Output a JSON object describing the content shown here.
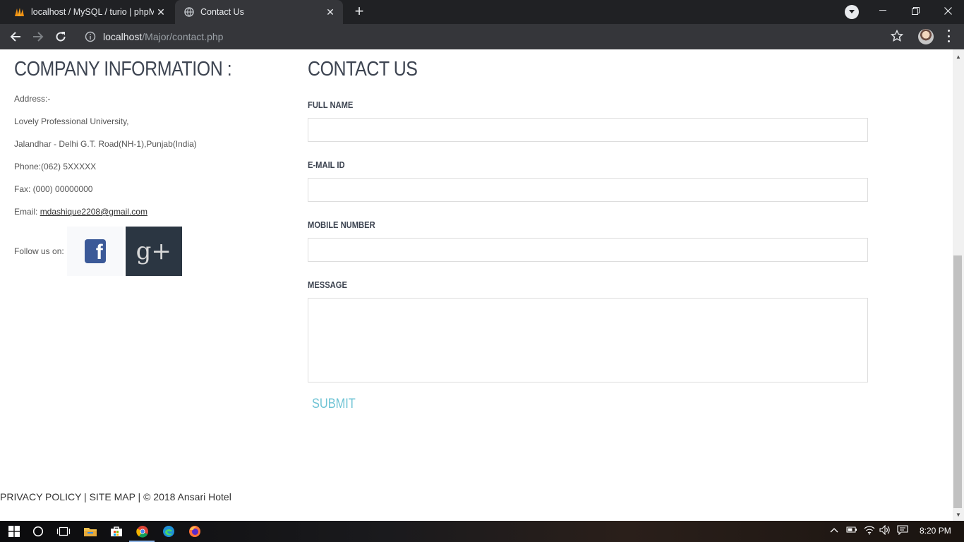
{
  "browser": {
    "tabs": [
      {
        "title": "localhost / MySQL / turio | phpM",
        "active": false,
        "icon": "phpmyadmin-icon"
      },
      {
        "title": "Contact Us",
        "active": true,
        "icon": "globe-icon"
      }
    ],
    "url_host": "localhost",
    "url_path": "/Major/contact.php"
  },
  "company": {
    "heading": "COMPANY INFORMATION :",
    "address_label": "Address:-",
    "address_line1": "Lovely Professional University,",
    "address_line2": "Jalandhar - Delhi G.T. Road(NH-1),Punjab(India)",
    "phone": "Phone:(062) 5XXXXX",
    "fax": "Fax: (000) 00000000",
    "email_label": "Email: ",
    "email": "mdashique2208@gmail.com",
    "follow_label": "Follow us on:",
    "social": {
      "facebook": "f",
      "googleplus": "g+"
    }
  },
  "contact": {
    "heading": "CONTACT US",
    "full_name_label": "FULL NAME",
    "email_label": "E-MAIL ID",
    "mobile_label": "MOBILE NUMBER",
    "message_label": "MESSAGE",
    "submit_label": "SUBMIT"
  },
  "footer": {
    "text": "PRIVACY POLICY | SITE MAP | © 2018 Ansari Hotel"
  },
  "taskbar": {
    "time": "8:20 PM"
  },
  "colors": {
    "heading": "#3d4451",
    "submit": "#6ec3d4",
    "chrome_dark": "#202124",
    "chrome_toolbar": "#35363a"
  }
}
